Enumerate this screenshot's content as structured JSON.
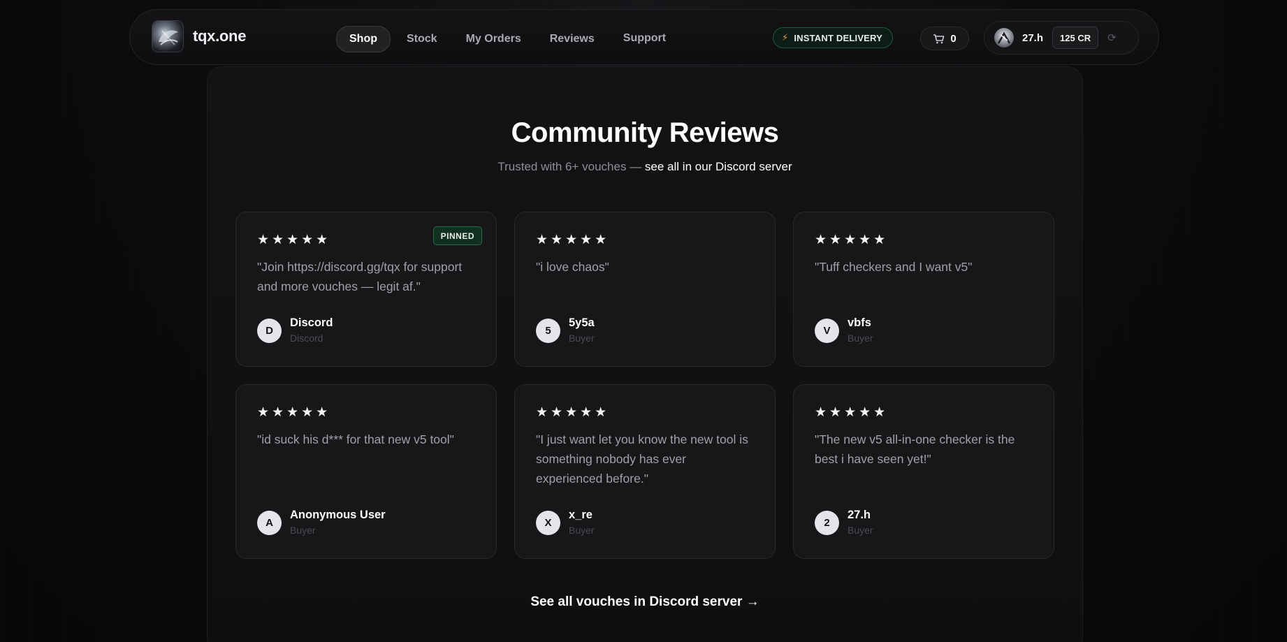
{
  "brand": {
    "name": "tqx.one"
  },
  "nav": {
    "links": [
      {
        "label": "Shop",
        "active": true
      },
      {
        "label": "Stock",
        "active": false
      },
      {
        "label": "My Orders",
        "active": false
      },
      {
        "label": "Reviews",
        "active": false
      },
      {
        "label": "Support",
        "active": false
      }
    ]
  },
  "delivery_badge": "INSTANT DELIVERY",
  "cart": {
    "count": "0"
  },
  "user": {
    "name": "27.h",
    "credits": "125 CR"
  },
  "section": {
    "title": "Community Reviews",
    "subtitle_prefix": "Trusted with 6+ vouches — ",
    "subtitle_link": "see all in our Discord server"
  },
  "reviews": [
    {
      "stars": "★★★★★",
      "pinned": "PINNED",
      "quote": "\"Join https://discord.gg/tqx for support and more vouches — legit af.\"",
      "initial": "D",
      "name": "Discord",
      "role": "Discord"
    },
    {
      "stars": "★★★★★",
      "quote": "\"i love chaos\"",
      "initial": "5",
      "name": "5y5a",
      "role": "Buyer"
    },
    {
      "stars": "★★★★★",
      "quote": "\"Tuff checkers and I want v5\"",
      "initial": "V",
      "name": "vbfs",
      "role": "Buyer"
    },
    {
      "stars": "★★★★★",
      "quote": "\"id suck his d*** for that new v5 tool\"",
      "initial": "A",
      "name": "Anonymous User",
      "role": "Buyer"
    },
    {
      "stars": "★★★★★",
      "quote": "\"I just want let you know the new tool is something nobody has ever experienced before.\"",
      "initial": "X",
      "name": "x_re",
      "role": "Buyer"
    },
    {
      "stars": "★★★★★",
      "quote": "\"The new v5 all-in-one checker is the best i have seen yet!\"",
      "initial": "2",
      "name": "27.h",
      "role": "Buyer"
    }
  ],
  "footer_link": "See all vouches in Discord server →",
  "colors": {
    "accent_green": "#1e5a3a",
    "bolt": "#f0a040",
    "background": "#0c0c0d"
  },
  "icons": [
    "logo-icon",
    "bolt-icon",
    "cart-icon",
    "user-avatar-icon",
    "refresh-icon",
    "star-icon"
  ]
}
